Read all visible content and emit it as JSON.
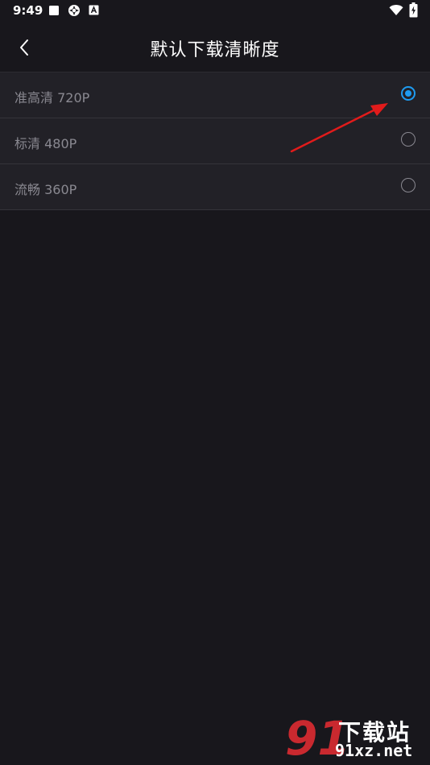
{
  "status_bar": {
    "time": "9:49",
    "left_icons": [
      "stop-square-icon",
      "app-bird-icon",
      "app-a-icon"
    ],
    "right_icons": [
      "wifi-icon",
      "battery-charging-icon"
    ]
  },
  "header": {
    "title": "默认下载清晰度",
    "back_icon": "chevron-left-icon"
  },
  "options": [
    {
      "label": "准高清 720P",
      "selected": true
    },
    {
      "label": "标清 480P",
      "selected": false
    },
    {
      "label": "流畅 360P",
      "selected": false
    }
  ],
  "colors": {
    "background": "#18171c",
    "list_background": "#222127",
    "accent": "#1e9bf0",
    "annotation_arrow": "#e11b1b",
    "watermark_red": "#c9292f"
  },
  "watermark": {
    "mark": "91",
    "title": "下载站",
    "domain": "91xz.net"
  }
}
